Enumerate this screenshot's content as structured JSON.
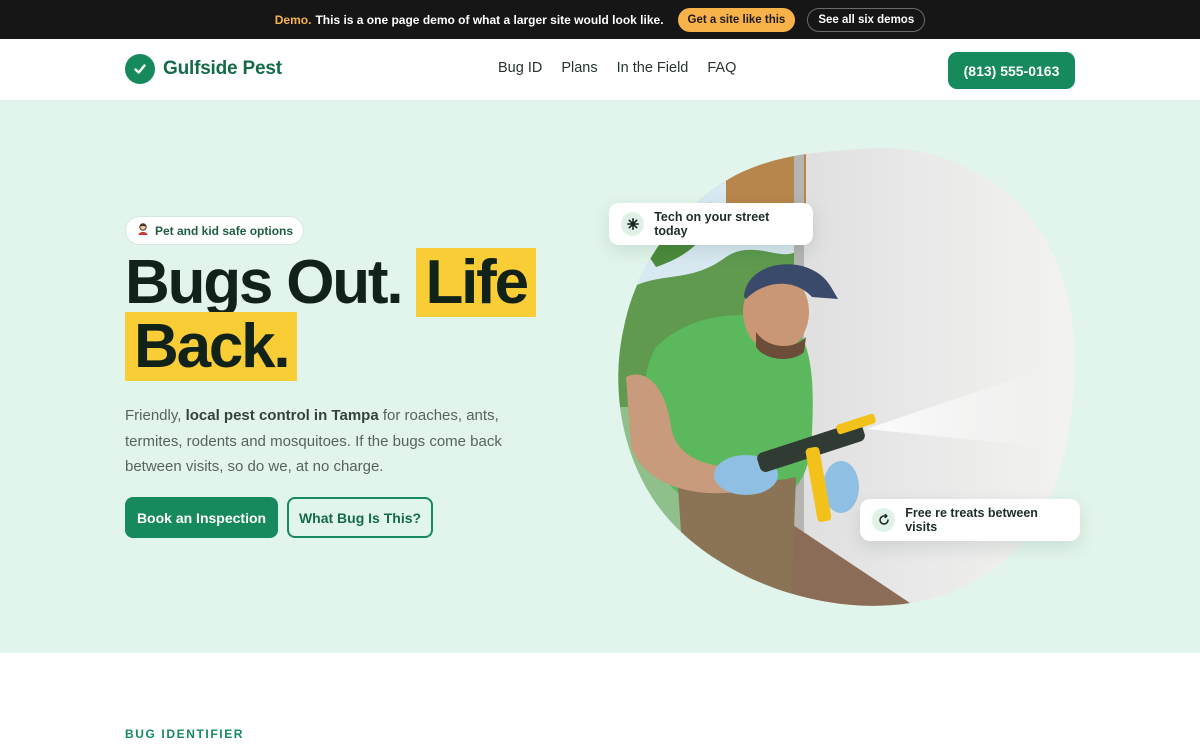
{
  "demo_bar": {
    "tag": "Demo.",
    "text": "This is a one page demo of what a larger site would look like.",
    "cta_label": "Get a site like this",
    "all_label": "See all six demos"
  },
  "header": {
    "brand": "Gulfside Pest",
    "nav": [
      "Bug ID",
      "Plans",
      "In the Field",
      "FAQ"
    ],
    "phone": "(813) 555-0163"
  },
  "hero": {
    "badge_icon": "person-icon",
    "badge": "Pet and kid safe options",
    "headline": {
      "line1_plain": "Bugs Out.",
      "line1_highlight": "Life",
      "line2_highlight": "Back."
    },
    "sub": {
      "before": "Friendly,",
      "bold": "local pest control in Tampa",
      "after": "for roaches, ants, termites, rodents and mosquitoes. If the bugs come back between visits, so do we, at no charge."
    },
    "primary_cta": "Book an Inspection",
    "secondary_cta": "What Bug Is This?",
    "card_tech": {
      "icon": "sparkle-icon",
      "text": "Tech on your street today"
    },
    "card_free": {
      "icon": "refresh-icon",
      "text": "Free re treats between visits"
    }
  },
  "section": {
    "label": "BUG IDENTIFIER"
  },
  "colors": {
    "brand_green": "#168a5c",
    "highlight_yellow": "#f8cd35",
    "hero_bg": "#e2f5ec",
    "demo_orange": "#f7b24a"
  }
}
